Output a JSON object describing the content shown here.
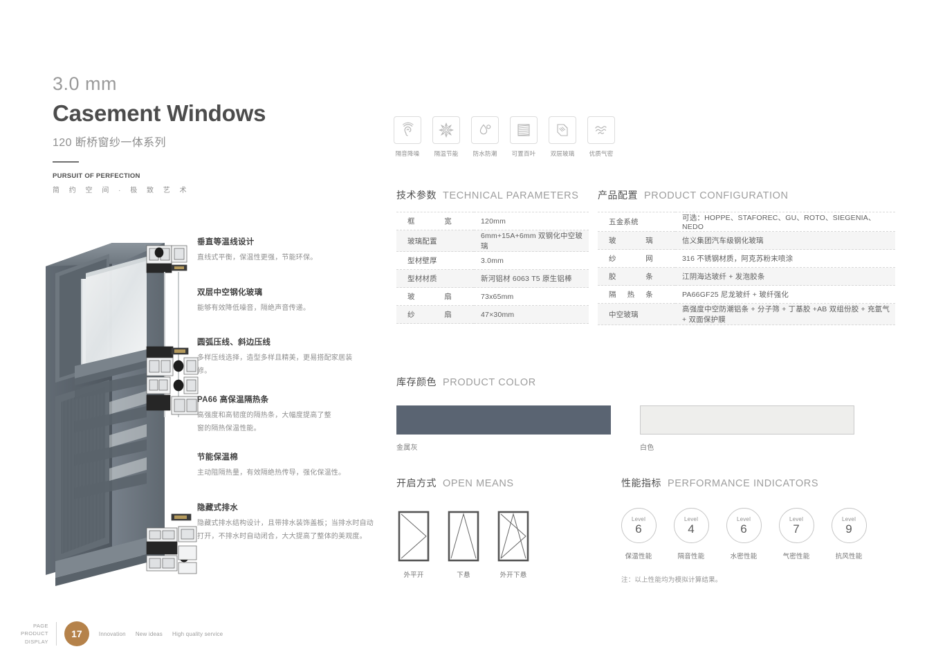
{
  "header": {
    "size": "3.0 mm",
    "title": "Casement Windows",
    "subtitle": "120 断桥窗纱一体系列",
    "tagline_en": "PURSUIT OF PERFECTION",
    "tagline_cn": "简 约 空 间 · 极 致 艺 术"
  },
  "feature_icons": [
    {
      "icon": "ear-sound-icon",
      "label": "隔音降噪"
    },
    {
      "icon": "sun-thermal-icon",
      "label": "隔温节能"
    },
    {
      "icon": "water-drop-icon",
      "label": "防水防潮"
    },
    {
      "icon": "blinds-icon",
      "label": "可置百叶"
    },
    {
      "icon": "double-glass-icon",
      "label": "双层玻璃"
    },
    {
      "icon": "airtight-icon",
      "label": "优质气密"
    }
  ],
  "features": [
    {
      "heading": "垂直等温线设计",
      "body": "直线式平衡，保温性更强，节能环保。"
    },
    {
      "heading": "双层中空钢化玻璃",
      "body": "能够有效降低噪音，隔绝声音传递。"
    },
    {
      "heading": "圆弧压线、斜边压线",
      "body": "多样压线选择，造型多样且精美，更易搭配家居装修。"
    },
    {
      "heading": "PA66 高保温隔热条",
      "body": "高强度和高韧度的隔热条，大幅度提高了整窗的隔热保温性能。"
    },
    {
      "heading": "节能保温棉",
      "body": "主动阻隔热量，有效隔绝热传导，强化保温性。"
    },
    {
      "heading": "隐藏式排水",
      "body": "隐藏式排水结构设计，且带排水装饰盖板；当排水时自动打开，不排水时自动闭合，大大提高了整体的美观度。"
    }
  ],
  "technical": {
    "title_cn": "技术参数",
    "title_en": "TECHNICAL PARAMETERS",
    "rows": [
      {
        "key": "框宽",
        "value": "120mm"
      },
      {
        "key": "玻璃配置",
        "value": "6mm+15A+6mm 双钢化中空玻璃"
      },
      {
        "key": "型材壁厚",
        "value": "3.0mm"
      },
      {
        "key": "型材材质",
        "value": "新河铝材  6063 T5 原生铝棒"
      },
      {
        "key": "玻扇",
        "value": "73x65mm"
      },
      {
        "key": "纱扇",
        "value": "47×30mm"
      }
    ]
  },
  "configuration": {
    "title_cn": "产品配置",
    "title_en": "PRODUCT CONFIGURATION",
    "rows": [
      {
        "key": "五金系统",
        "value": "可选：HOPPE、STAFOREC、GU、ROTO、SIEGENIA、NEDO"
      },
      {
        "key": "玻璃",
        "value": "信义集团汽车级钢化玻璃"
      },
      {
        "key": "纱网",
        "value": "316 不锈钢材质，阿克苏粉末喷涂"
      },
      {
        "key": "胶条",
        "value": "江阴海达玻纤 + 发泡胶条"
      },
      {
        "key": "隔热条",
        "value": "PA66GF25 尼龙玻纤 + 玻纤强化"
      },
      {
        "key": "中空玻璃",
        "value": "高强度中空防潮铝条 + 分子筛 + 丁基胶 +AB 双组份胶 + 充氩气 + 双面保护膜"
      }
    ]
  },
  "color": {
    "title_cn": "库存颜色",
    "title_en": "PRODUCT COLOR",
    "swatches": [
      {
        "label": "金属灰",
        "hex": "#5a6472"
      },
      {
        "label": "白色",
        "hex": "#eeeeec"
      }
    ]
  },
  "open_means": {
    "title_cn": "开启方式",
    "title_en": "OPEN MEANS",
    "items": [
      {
        "label": "外平开",
        "type": "side-hung"
      },
      {
        "label": "下悬",
        "type": "bottom-hung"
      },
      {
        "label": "外开下悬",
        "type": "tilt-and-turn"
      }
    ]
  },
  "performance": {
    "title_cn": "性能指标",
    "title_en": "PERFORMANCE INDICATORS",
    "level_word": "Level",
    "items": [
      {
        "level": "6",
        "label": "保温性能"
      },
      {
        "level": "4",
        "label": "隔音性能"
      },
      {
        "level": "6",
        "label": "水密性能"
      },
      {
        "level": "7",
        "label": "气密性能"
      },
      {
        "level": "9",
        "label": "抗风性能"
      }
    ],
    "note": "注：以上性能均为模拟计算结果。"
  },
  "footer": {
    "stack": [
      "PAGE",
      "PRODUCT",
      "DISPLAY"
    ],
    "page_number": "17",
    "tags": [
      "Innovation",
      "New ideas",
      "High quality service"
    ],
    "accent_hex": "#b5824a"
  }
}
